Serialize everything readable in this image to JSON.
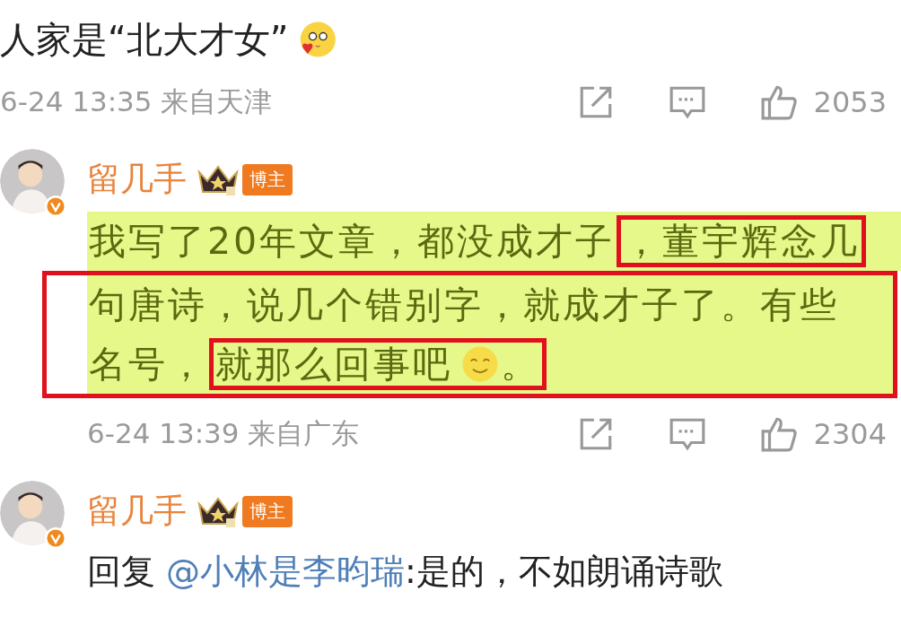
{
  "comments": [
    {
      "kind": "plain",
      "parts": [
        {
          "kind": "text",
          "text": "人家是“北大才女”"
        },
        {
          "kind": "kiss-emoji"
        }
      ],
      "meta": "6-24 13:35 来自天津",
      "likes": "2053"
    },
    {
      "kind": "annotated",
      "author": "留几手",
      "verified": true,
      "badge": "博主",
      "highlighted": true,
      "blocks": [
        {
          "boxed": false,
          "lines": [
            {
              "segments": [
                {
                  "boxed": false,
                  "parts": [
                    {
                      "kind": "text",
                      "text": "我写了20年文章，都没成才子"
                    }
                  ]
                },
                {
                  "boxed": true,
                  "parts": [
                    {
                      "kind": "text",
                      "text": "，董宇辉念几"
                    }
                  ]
                }
              ]
            }
          ]
        },
        {
          "boxed": true,
          "lines": [
            {
              "segments": [
                {
                  "boxed": false,
                  "parts": [
                    {
                      "kind": "text",
                      "text": "句唐诗，说几个错别字，就成才子了。有些"
                    }
                  ]
                }
              ]
            },
            {
              "segments": [
                {
                  "boxed": false,
                  "parts": [
                    {
                      "kind": "text",
                      "text": "名号，"
                    }
                  ]
                },
                {
                  "boxed": true,
                  "parts": [
                    {
                      "kind": "text",
                      "text": "就那么回事吧"
                    },
                    {
                      "kind": "smile-emoji"
                    },
                    {
                      "kind": "text",
                      "text": "。"
                    }
                  ]
                }
              ]
            }
          ]
        }
      ],
      "meta": "6-24 13:39 来自广东",
      "likes": "2304"
    },
    {
      "kind": "reply",
      "author": "留几手",
      "verified": true,
      "badge": "博主",
      "reply": {
        "prefix": "回复",
        "mention": "@小林是李昀瑞",
        "text": ":是的，不如朗诵诗歌"
      }
    }
  ]
}
